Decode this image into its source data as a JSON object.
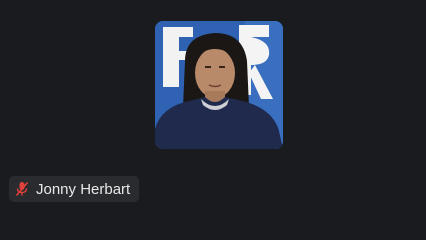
{
  "participant": {
    "name": "Jonny Herbart",
    "mic_status": "muted",
    "mic_icon": "mic-muted-icon"
  },
  "colors": {
    "background": "#1a1b1e",
    "name_tag_bg": "#2a2b2e",
    "muted_red": "#e0413a"
  }
}
